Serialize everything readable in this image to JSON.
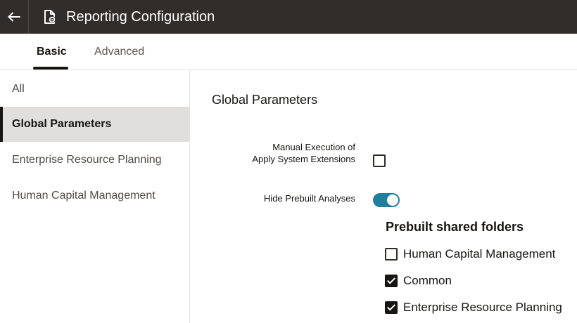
{
  "header": {
    "title": "Reporting Configuration",
    "back_icon": "arrow-left-icon",
    "doc_icon": "document-settings-icon",
    "background_color": "#312d2a"
  },
  "tabs": [
    {
      "label": "Basic",
      "selected": true
    },
    {
      "label": "Advanced",
      "selected": false
    }
  ],
  "sidebar": {
    "items": [
      {
        "label": "All",
        "selected": false
      },
      {
        "label": "Global Parameters",
        "selected": true
      },
      {
        "label": "Enterprise Resource Planning",
        "selected": false
      },
      {
        "label": "Human Capital Management",
        "selected": false
      }
    ]
  },
  "main": {
    "section_title": "Global Parameters",
    "manual_execution": {
      "label_line1": "Manual Execution of",
      "label_line2": "Apply System Extensions",
      "checked": false
    },
    "hide_prebuilt": {
      "label": "Hide Prebuilt Analyses",
      "on": true,
      "accent_color": "#227e9e"
    },
    "prebuilt_folders": {
      "heading": "Prebuilt shared folders",
      "items": [
        {
          "label": "Human Capital Management",
          "checked": false
        },
        {
          "label": "Common",
          "checked": true
        },
        {
          "label": "Enterprise Resource Planning",
          "checked": true
        }
      ]
    }
  }
}
